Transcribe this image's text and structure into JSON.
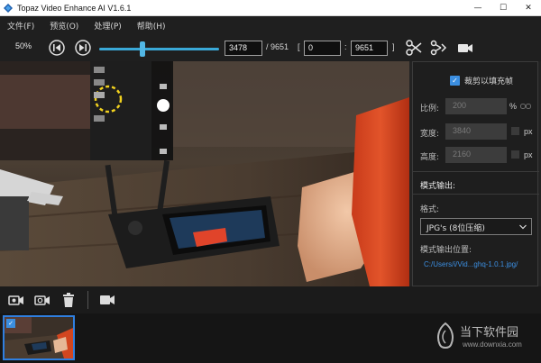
{
  "window": {
    "title": "Topaz Video Enhance AI V1.6.1",
    "controls": {
      "minimize": "—",
      "maximize": "☐",
      "close": "✕"
    }
  },
  "menu": {
    "items": [
      "文件(F)",
      "预览(O)",
      "处理(P)",
      "帮助(H)"
    ]
  },
  "toolbar": {
    "zoom": "50%",
    "playback_progress": 0.36,
    "current_frame": "3478",
    "total_frames_label": "/ 9651",
    "range_open": "[",
    "range_start": "0",
    "range_sep": ":",
    "range_end": "9651",
    "range_close": "]",
    "icons": [
      "prev-frame-icon",
      "next-frame-icon",
      "cut-icon",
      "trim-icon",
      "camera-icon"
    ]
  },
  "panel": {
    "crop_fill_label": "裁剪以填充帧",
    "crop_fill_checked": true,
    "scale_label": "比例:",
    "scale_value": "200",
    "scale_unit": "%",
    "width_label": "宽度:",
    "width_value": "3840",
    "width_unit": "px",
    "height_label": "高度:",
    "height_value": "2160",
    "height_unit": "px",
    "output_title": "模式输出:",
    "format_label": "格式:",
    "format_value": "JPG's (8位压缩)",
    "output_location_label": "模式输出位置:",
    "output_path": "C:/Users/i/Vid...ghq-1.0.1.jpg/"
  },
  "bottom_toolbar": {
    "icons": [
      "add-video-icon",
      "import-video-icon",
      "trash-icon",
      "video-output-icon"
    ]
  },
  "filmstrip": {
    "items": [
      {
        "selected": true
      }
    ]
  },
  "watermark": {
    "line1": "当下软件园",
    "line2": "www.downxia.com"
  },
  "colors": {
    "accent": "#3aa9d8",
    "link": "#3c8fe2",
    "checkbox": "#3b8ee0",
    "dark_bg": "#1b1b1b"
  }
}
